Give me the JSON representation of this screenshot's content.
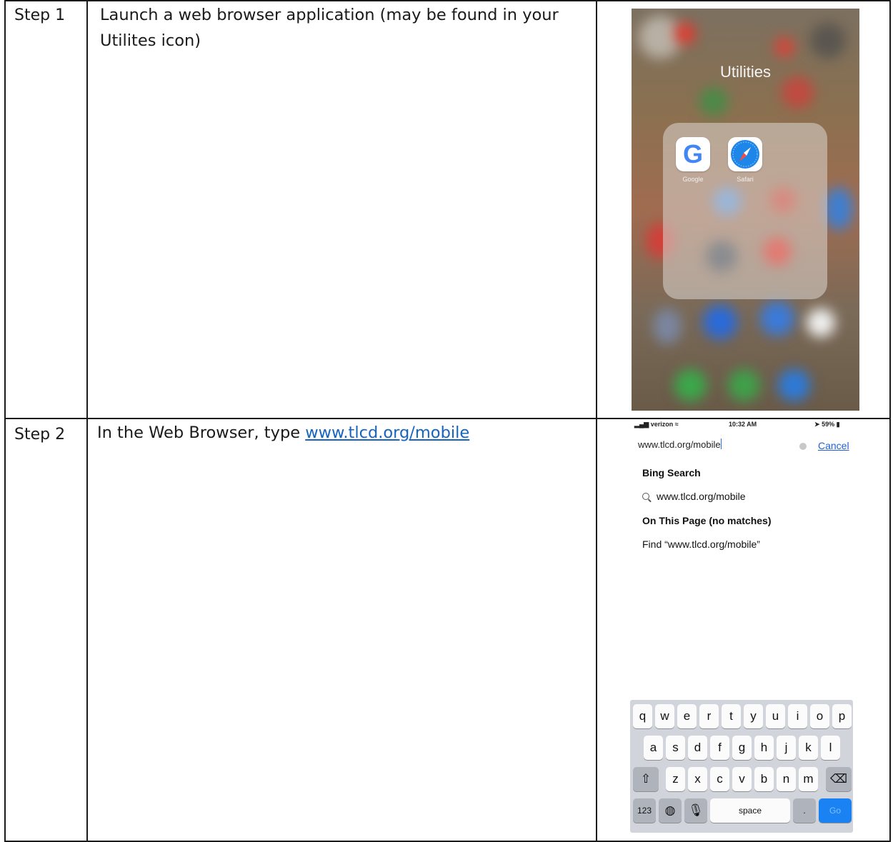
{
  "rows": [
    {
      "step": "Step 1",
      "instruction": "Launch a web browser application (may be found in your Utilites icon)",
      "instruction_line1": "Launch a web browser application (may be found in your",
      "instruction_line2": "Utilites icon)",
      "screenshot": {
        "folder_title": "Utilities",
        "apps": [
          {
            "name": "Google",
            "icon": "google-g-icon",
            "letter": "G"
          },
          {
            "name": "Safari",
            "icon": "safari-compass-icon"
          }
        ],
        "app_labels": [
          "Google",
          "Safari"
        ]
      }
    },
    {
      "step": "Step 2",
      "instruction_prefix": "In the Web Browser, type ",
      "instruction_link": "www.tlcd.org/mobile",
      "screenshot": {
        "status_carrier": "verizon",
        "status_time": "10:32 AM",
        "status_battery": "59%",
        "url_value": "www.tlcd.org/mobile",
        "cancel_label": "Cancel",
        "suggestion_heading_1": "Bing Search",
        "suggestion_query": "www.tlcd.org/mobile",
        "suggestion_heading_2": "On This Page (no matches)",
        "find_text": "Find “www.tlcd.org/mobile”",
        "keyboard": {
          "row1": [
            "q",
            "w",
            "e",
            "r",
            "t",
            "y",
            "u",
            "i",
            "o",
            "p"
          ],
          "row2": [
            "a",
            "s",
            "d",
            "f",
            "g",
            "h",
            "j",
            "k",
            "l"
          ],
          "row3": [
            "z",
            "x",
            "c",
            "v",
            "b",
            "n",
            "m"
          ],
          "numbers_key": "123",
          "space_key": "space",
          "period_key": ".",
          "go_key": "Go"
        }
      }
    }
  ],
  "colors": {
    "link": "#1565c0",
    "ios_blue": "#1a82f2",
    "keyboard_bg": "#d1d4da"
  }
}
